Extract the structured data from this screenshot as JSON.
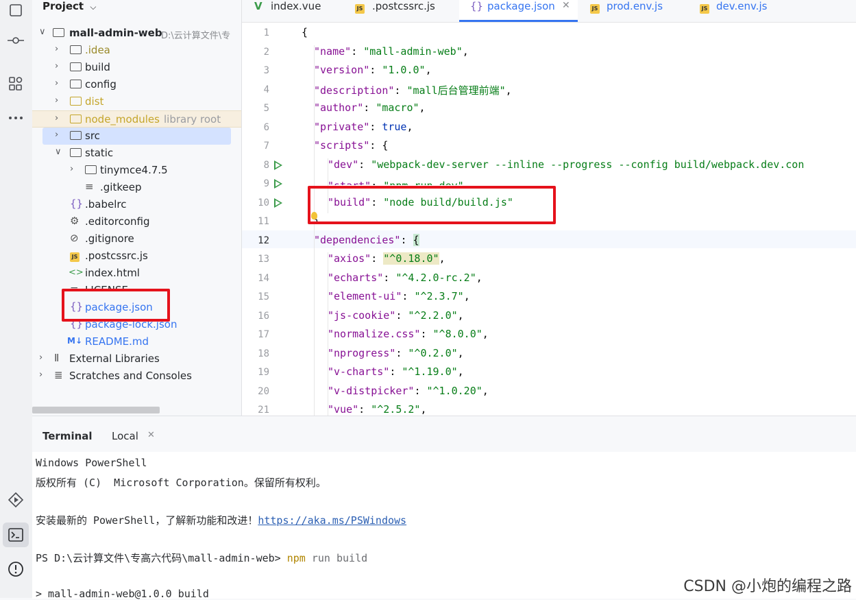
{
  "project": {
    "title": "Project",
    "tree": [
      {
        "label": "mall-admin-web",
        "hint": "D:\\云计算文件\\专",
        "type": "folder-open"
      },
      {
        "label": ".idea",
        "type": "folder"
      },
      {
        "label": "build",
        "type": "folder"
      },
      {
        "label": "config",
        "type": "folder"
      },
      {
        "label": "dist",
        "type": "folder"
      },
      {
        "label": "node_modules",
        "hint": "library root",
        "type": "folder"
      },
      {
        "label": "src",
        "type": "folder"
      },
      {
        "label": "static",
        "type": "folder-open"
      },
      {
        "label": "tinymce4.7.5",
        "type": "folder"
      },
      {
        "label": ".gitkeep",
        "type": "file"
      },
      {
        "label": ".babelrc",
        "type": "json"
      },
      {
        "label": ".editorconfig",
        "type": "gear"
      },
      {
        "label": ".gitignore",
        "type": "ignore"
      },
      {
        "label": ".postcssrc.js",
        "type": "js"
      },
      {
        "label": "index.html",
        "type": "html"
      },
      {
        "label": "LICENSE",
        "type": "file"
      },
      {
        "label": "package.json",
        "type": "json"
      },
      {
        "label": "package-lock.json",
        "type": "json"
      },
      {
        "label": "README.md",
        "type": "md"
      },
      {
        "label": "External Libraries",
        "type": "lib"
      },
      {
        "label": "Scratches and Consoles",
        "type": "scratch"
      }
    ]
  },
  "tabs": [
    {
      "label": "index.vue",
      "icon": "vue-icon"
    },
    {
      "label": ".postcssrc.js",
      "icon": "js-icon"
    },
    {
      "label": "package.json",
      "icon": "json-icon",
      "active": true
    },
    {
      "label": "prod.env.js",
      "icon": "js-icon"
    },
    {
      "label": "dev.env.js",
      "icon": "js-icon"
    }
  ],
  "editor": {
    "current_line": 12,
    "lines": [
      {
        "n": "1",
        "text": "{"
      },
      {
        "n": "2",
        "key": "\"name\"",
        "val": "\"mall-admin-web\""
      },
      {
        "n": "3",
        "key": "\"version\"",
        "val": "\"1.0.0\""
      },
      {
        "n": "4",
        "key": "\"description\"",
        "val": "\"mall后台管理前端\""
      },
      {
        "n": "5",
        "key": "\"author\"",
        "val": "\"macro\""
      },
      {
        "n": "6",
        "key": "\"private\"",
        "val": "true"
      },
      {
        "n": "7",
        "key": "\"scripts\"",
        "val": "{"
      },
      {
        "n": "8",
        "key": "\"dev\"",
        "val": "\"webpack-dev-server --inline --progress --config build/webpack.dev.con"
      },
      {
        "n": "9",
        "key": "\"start\"",
        "val": "\"npm run dev\""
      },
      {
        "n": "10",
        "key": "\"build\"",
        "val": "\"node build/build.js\""
      },
      {
        "n": "11",
        "text": "},"
      },
      {
        "n": "12",
        "key": "\"dependencies\"",
        "val": "{"
      },
      {
        "n": "13",
        "key": "\"axios\"",
        "val": "\"^0.18.0\""
      },
      {
        "n": "14",
        "key": "\"echarts\"",
        "val": "\"^4.2.0-rc.2\""
      },
      {
        "n": "15",
        "key": "\"element-ui\"",
        "val": "\"^2.3.7\""
      },
      {
        "n": "16",
        "key": "\"js-cookie\"",
        "val": "\"^2.2.0\""
      },
      {
        "n": "17",
        "key": "\"normalize.css\"",
        "val": "\"^8.0.0\""
      },
      {
        "n": "18",
        "key": "\"nprogress\"",
        "val": "\"^0.2.0\""
      },
      {
        "n": "19",
        "key": "\"v-charts\"",
        "val": "\"^1.19.0\""
      },
      {
        "n": "20",
        "key": "\"v-distpicker\"",
        "val": "\"^1.0.20\""
      },
      {
        "n": "21",
        "key": "\"vue\"",
        "val": "\"^2.5.2\""
      }
    ]
  },
  "terminal": {
    "title": "Terminal",
    "tab": "Local",
    "lines": {
      "l1": "Windows PowerShell",
      "l2": "版权所有 (C)  Microsoft Corporation。保留所有权利。",
      "l3_prefix": "安装最新的 PowerShell，了解新功能和改进！",
      "l3_link": "https://aka.ms/PSWindows",
      "prompt": "PS D:\\云计算文件\\专高六代码\\mall-admin-web>",
      "cmd": "npm",
      "args": " run build",
      "l5": "> mall-admin-web@1.0.0 build"
    }
  },
  "watermark": "CSDN @小炮的编程之路",
  "colors": {
    "accent": "#3574f0",
    "highlight_box": "#e5121b",
    "run_icon": "#3b9b4a"
  }
}
